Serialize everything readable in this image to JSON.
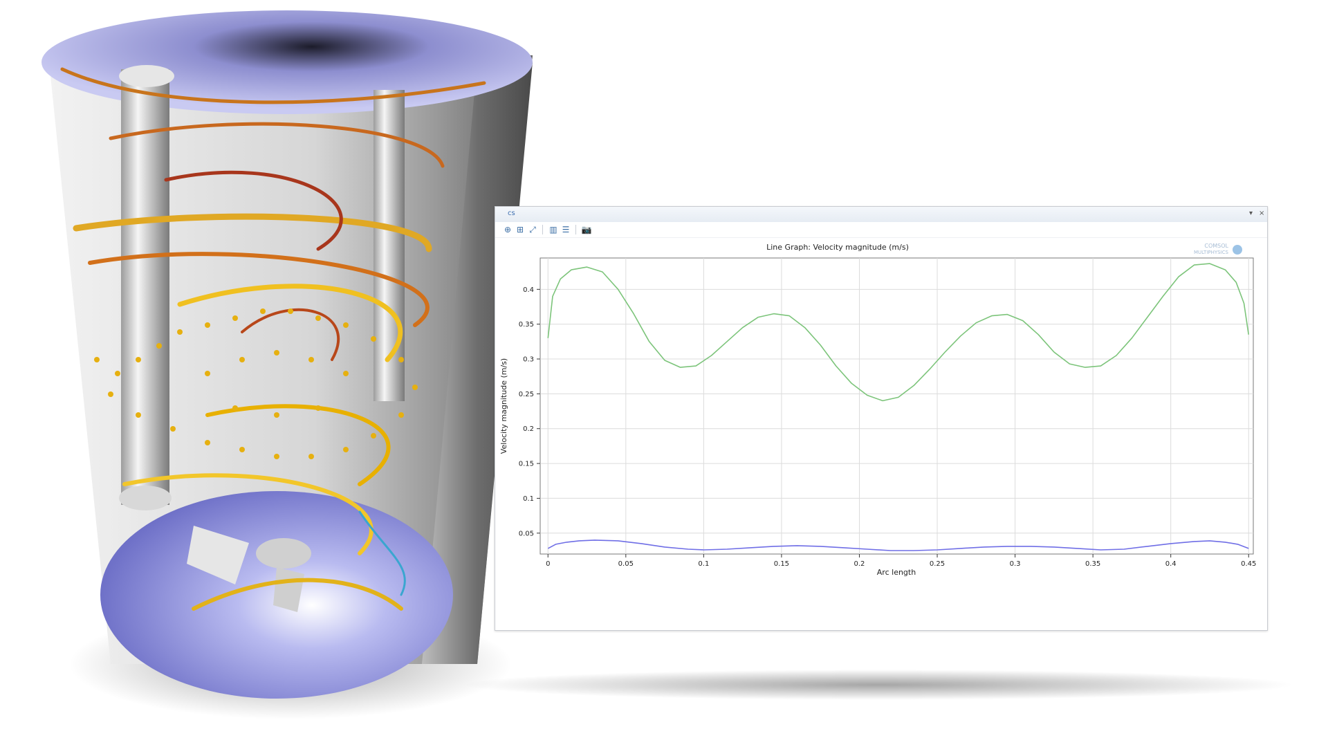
{
  "window": {
    "title": "cs",
    "pin_glyph": "▾",
    "close_glyph": "×"
  },
  "toolbar": {
    "items": [
      {
        "name": "zoom-in-icon",
        "glyph": "⊕"
      },
      {
        "name": "zoom-box-icon",
        "glyph": "⊞"
      },
      {
        "name": "zoom-extents-icon",
        "glyph": "⤢"
      },
      {
        "name": "grid-icon",
        "glyph": "▥"
      },
      {
        "name": "legend-icon",
        "glyph": "☰"
      },
      {
        "name": "camera-icon",
        "glyph": "📷"
      }
    ]
  },
  "logo": {
    "line1": "COMSOL",
    "line2": "MULTIPHYSICS"
  },
  "colors": {
    "series_upper": "#7cc47a",
    "series_lower": "#6f6ee6",
    "grid": "#dcdcdc",
    "axis": "#333333"
  },
  "chart_data": {
    "type": "line",
    "title": "Line Graph: Velocity magnitude (m/s)",
    "xlabel": "Arc length",
    "ylabel": "Velocity magnitude (m/s)",
    "xlim": [
      -0.005,
      0.453
    ],
    "ylim": [
      0.02,
      0.445
    ],
    "xticks": [
      0,
      0.05,
      0.1,
      0.15,
      0.2,
      0.25,
      0.3,
      0.35,
      0.4,
      0.45
    ],
    "xtick_labels": [
      "0",
      "0.05",
      "0.1",
      "0.15",
      "0.2",
      "0.25",
      "0.3",
      "0.35",
      "0.4",
      "0.45"
    ],
    "yticks": [
      0.05,
      0.1,
      0.15,
      0.2,
      0.25,
      0.3,
      0.35,
      0.4
    ],
    "ytick_labels": [
      "0.05",
      "0.1",
      "0.15",
      "0.2",
      "0.25",
      "0.3",
      "0.35",
      "0.4"
    ],
    "grid": true,
    "series": [
      {
        "x": [
          0,
          0.003,
          0.008,
          0.015,
          0.025,
          0.035,
          0.045,
          0.055,
          0.065,
          0.075,
          0.085,
          0.095,
          0.105,
          0.115,
          0.125,
          0.135,
          0.145,
          0.155,
          0.165,
          0.175,
          0.185,
          0.195,
          0.205,
          0.215,
          0.225,
          0.235,
          0.245,
          0.255,
          0.265,
          0.275,
          0.285,
          0.295,
          0.305,
          0.315,
          0.325,
          0.335,
          0.345,
          0.355,
          0.365,
          0.375,
          0.385,
          0.395,
          0.405,
          0.415,
          0.425,
          0.435,
          0.442,
          0.447,
          0.45
        ],
        "y": [
          0.33,
          0.39,
          0.415,
          0.428,
          0.432,
          0.425,
          0.4,
          0.365,
          0.325,
          0.298,
          0.288,
          0.29,
          0.305,
          0.325,
          0.345,
          0.36,
          0.365,
          0.362,
          0.345,
          0.32,
          0.29,
          0.265,
          0.248,
          0.24,
          0.245,
          0.262,
          0.285,
          0.31,
          0.333,
          0.352,
          0.362,
          0.364,
          0.355,
          0.335,
          0.31,
          0.293,
          0.288,
          0.29,
          0.305,
          0.33,
          0.36,
          0.39,
          0.418,
          0.435,
          0.437,
          0.428,
          0.41,
          0.38,
          0.335
        ]
      },
      {
        "x": [
          0,
          0.005,
          0.012,
          0.02,
          0.03,
          0.045,
          0.06,
          0.075,
          0.09,
          0.1,
          0.115,
          0.13,
          0.145,
          0.16,
          0.175,
          0.19,
          0.205,
          0.22,
          0.235,
          0.25,
          0.265,
          0.28,
          0.295,
          0.31,
          0.325,
          0.34,
          0.355,
          0.37,
          0.385,
          0.4,
          0.415,
          0.425,
          0.435,
          0.443,
          0.45
        ],
        "y": [
          0.028,
          0.034,
          0.037,
          0.039,
          0.04,
          0.039,
          0.035,
          0.03,
          0.027,
          0.026,
          0.027,
          0.029,
          0.031,
          0.032,
          0.031,
          0.029,
          0.027,
          0.025,
          0.025,
          0.026,
          0.028,
          0.03,
          0.031,
          0.031,
          0.03,
          0.028,
          0.026,
          0.027,
          0.031,
          0.035,
          0.038,
          0.039,
          0.037,
          0.034,
          0.028
        ]
      }
    ]
  }
}
